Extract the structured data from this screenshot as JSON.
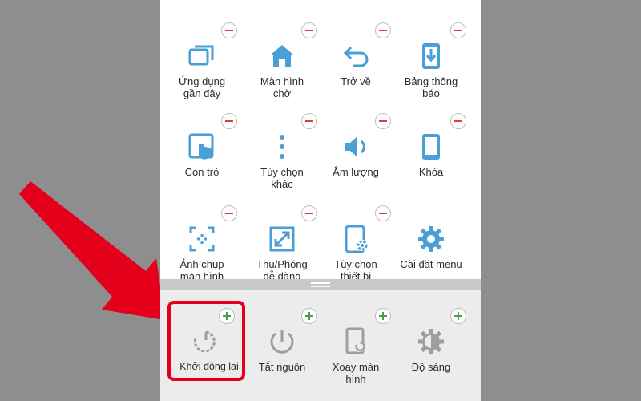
{
  "colors": {
    "background": "#8e8e8e",
    "panel": "#ffffff",
    "panel_lower": "#ececec",
    "icon_active": "#4a9fd6",
    "icon_inactive": "#9e9e9e",
    "remove_badge": "#e53935",
    "add_badge": "#43a047",
    "highlight": "#e4001b"
  },
  "active_items": [
    {
      "id": "recent",
      "icon": "recent-apps-icon",
      "label": "Ứng dụng\ngần đây"
    },
    {
      "id": "home",
      "icon": "home-icon",
      "label": "Màn hình\nchờ"
    },
    {
      "id": "back",
      "icon": "back-arrow-icon",
      "label": "Trở về"
    },
    {
      "id": "notif",
      "icon": "notification-panel-icon",
      "label": "Bảng thông\nbáo"
    },
    {
      "id": "cursor",
      "icon": "cursor-icon",
      "label": "Con trỏ"
    },
    {
      "id": "more",
      "icon": "more-options-icon",
      "label": "Tùy chọn\nkhác"
    },
    {
      "id": "volume",
      "icon": "volume-icon",
      "label": "Âm lượng"
    },
    {
      "id": "lock",
      "icon": "lock-device-icon",
      "label": "Khóa"
    },
    {
      "id": "screenshot",
      "icon": "screenshot-icon",
      "label": "Ảnh chụp\nmàn hình"
    },
    {
      "id": "zoom",
      "icon": "zoom-icon",
      "label": "Thu/Phóng\ndễ dàng"
    },
    {
      "id": "device",
      "icon": "device-options-icon",
      "label": "Tùy chọn\nthiết bị"
    },
    {
      "id": "settings",
      "icon": "gear-icon",
      "label": "Cài đặt menu"
    }
  ],
  "available_items": [
    {
      "id": "restart",
      "icon": "restart-icon",
      "label": "Khởi động lại"
    },
    {
      "id": "poweroff",
      "icon": "power-icon",
      "label": "Tắt nguồn"
    },
    {
      "id": "rotate",
      "icon": "rotate-screen-icon",
      "label": "Xoay màn\nhình"
    },
    {
      "id": "brightness",
      "icon": "brightness-icon",
      "label": "Độ sáng"
    }
  ]
}
